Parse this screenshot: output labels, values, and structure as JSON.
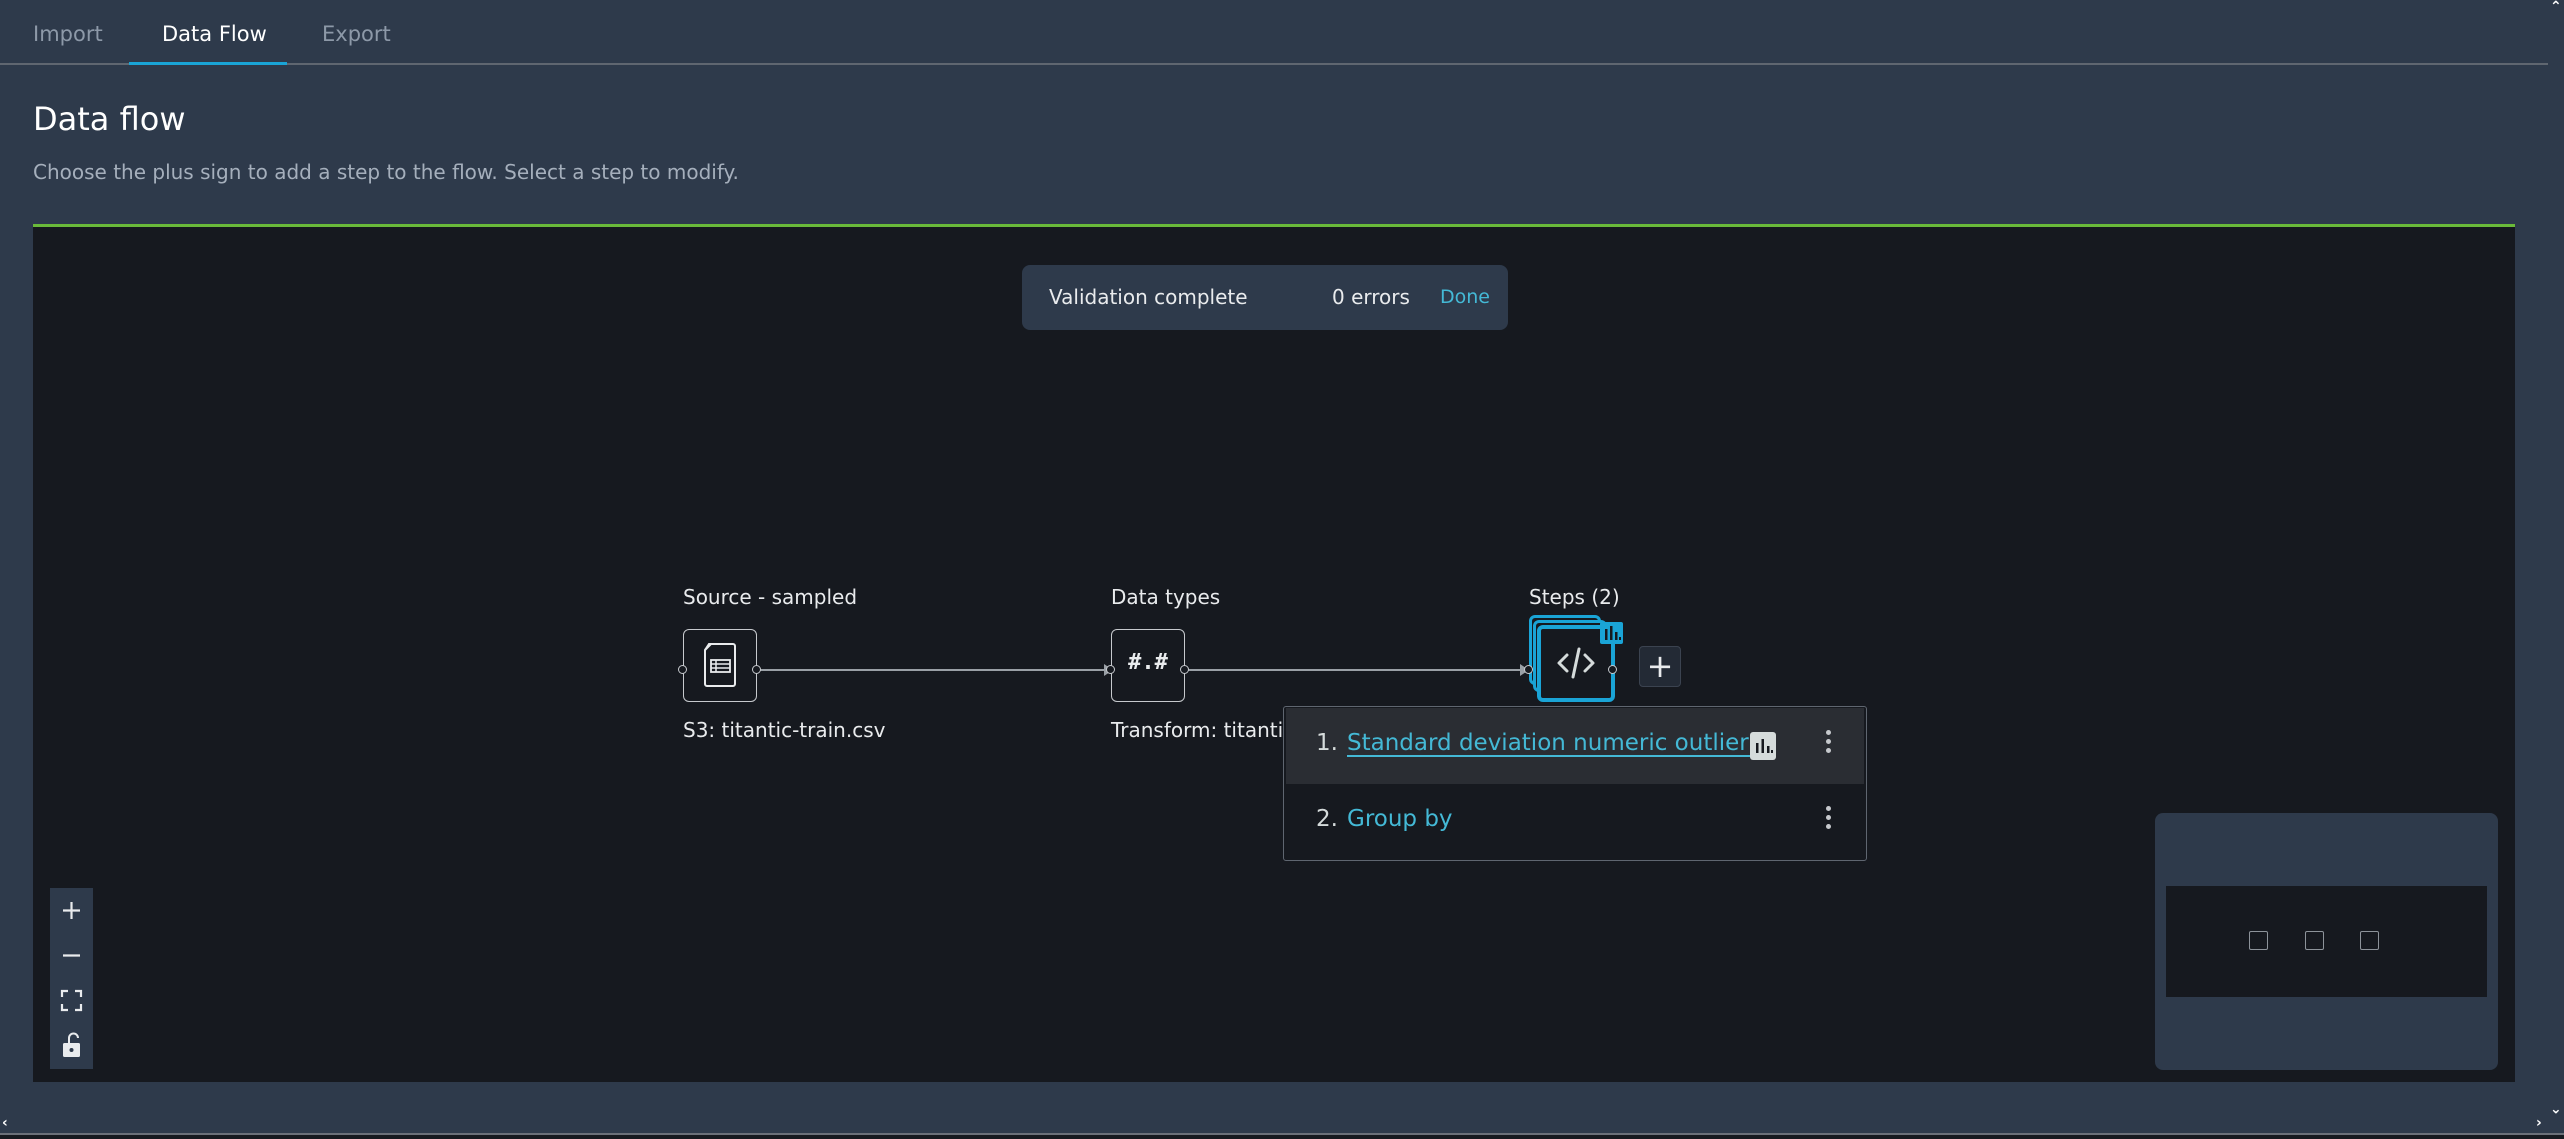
{
  "tabs": [
    {
      "label": "Import",
      "active": false
    },
    {
      "label": "Data Flow",
      "active": true
    },
    {
      "label": "Export",
      "active": false
    }
  ],
  "header": {
    "title": "Data flow",
    "description": "Choose the plus sign to add a step to the flow. Select a step to modify."
  },
  "validation": {
    "title": "Validation complete",
    "errors": "0 errors",
    "done_label": "Done"
  },
  "flow": {
    "nodes": [
      {
        "title": "Source - sampled",
        "subtitle": "S3: titantic-train.csv",
        "icon": "csv-file-icon"
      },
      {
        "title": "Data types",
        "subtitle": "Transform: titantic",
        "icon_text": "#.#"
      },
      {
        "title": "Steps (2)",
        "icon": "code-icon",
        "badge_icon": "chart-icon"
      }
    ],
    "add_step_label": "+"
  },
  "steps_popover": {
    "items": [
      {
        "number": "1.",
        "label": "Standard deviation numeric outliers",
        "has_chart": true
      },
      {
        "number": "2.",
        "label": "Group by",
        "has_chart": false
      }
    ]
  },
  "zoom_controls": [
    "zoom-in",
    "zoom-out",
    "fit-view",
    "lock"
  ],
  "colors": {
    "accent": "#1aa4d6",
    "link": "#44b9d6",
    "success": "#6aba3a",
    "canvas": "#16191f",
    "panel": "#2e3a4b"
  }
}
